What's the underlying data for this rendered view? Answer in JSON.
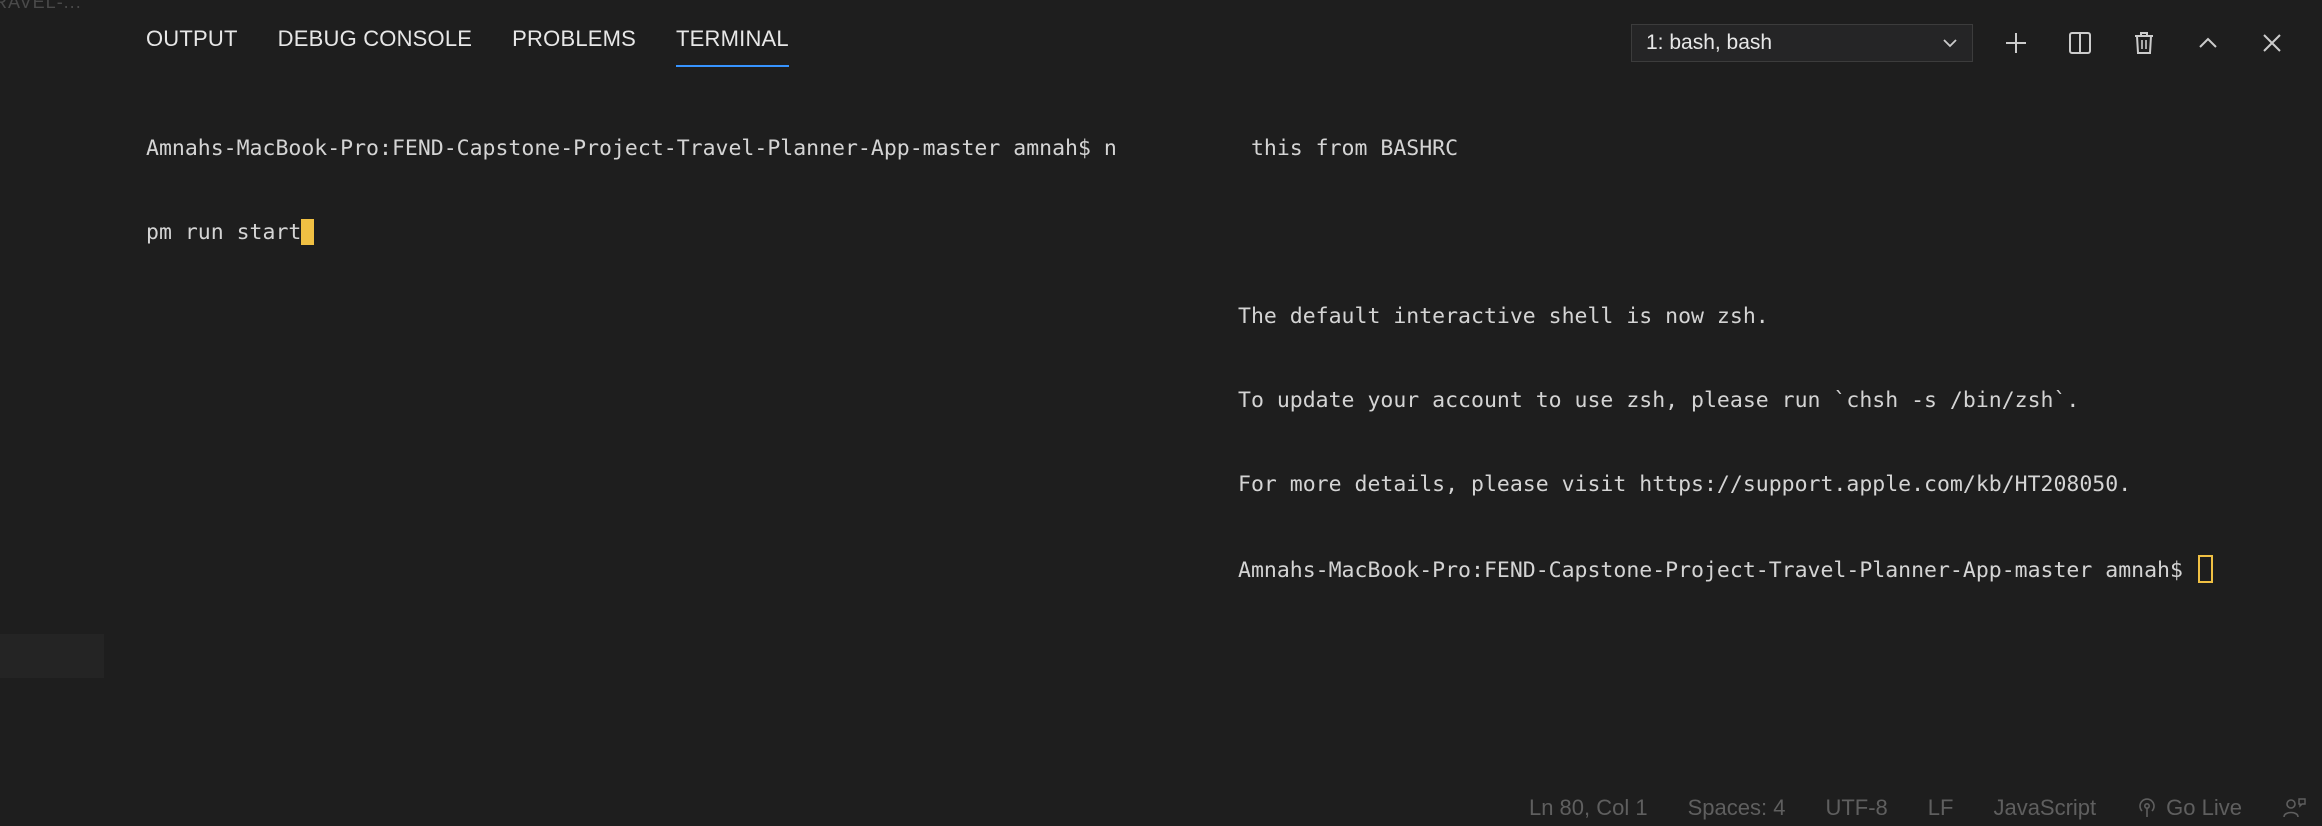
{
  "sidebar": {
    "faded_label": "RAVEL-..."
  },
  "panel": {
    "tabs": [
      {
        "label": "OUTPUT"
      },
      {
        "label": "DEBUG CONSOLE"
      },
      {
        "label": "PROBLEMS"
      },
      {
        "label": "TERMINAL",
        "active": true
      }
    ],
    "terminal_selector": {
      "value": "1: bash, bash"
    },
    "actions": [
      {
        "icon": "plus-icon",
        "label": "New Terminal"
      },
      {
        "icon": "split-icon",
        "label": "Split Terminal"
      },
      {
        "icon": "trash-icon",
        "label": "Kill Terminal"
      },
      {
        "icon": "chevron-up-icon",
        "label": "Maximize Panel"
      },
      {
        "icon": "close-icon",
        "label": "Close Panel"
      }
    ]
  },
  "terminal_left": {
    "lines": [
      "Amnahs-MacBook-Pro:FEND-Capstone-Project-Travel-Planner-App-master amnah$ n",
      "pm run start"
    ]
  },
  "terminal_right": {
    "lines": [
      " this from BASHRC",
      "",
      "The default interactive shell is now zsh.",
      "To update your account to use zsh, please run `chsh -s /bin/zsh`.",
      "For more details, please visit https://support.apple.com/kb/HT208050.",
      "Amnahs-MacBook-Pro:FEND-Capstone-Project-Travel-Planner-App-master amnah$ "
    ]
  },
  "statusbar": {
    "position": "Ln 80, Col 1",
    "spaces": "Spaces: 4",
    "encoding": "UTF-8",
    "eol": "LF",
    "language": "JavaScript",
    "go_live": "Go Live"
  },
  "colors": {
    "background": "#1e1e1e",
    "tab_active_underline": "#3794ff",
    "cursor": "#f0c043",
    "terminal_text": "#d4d4d4",
    "status_text": "#5f5f5f"
  }
}
